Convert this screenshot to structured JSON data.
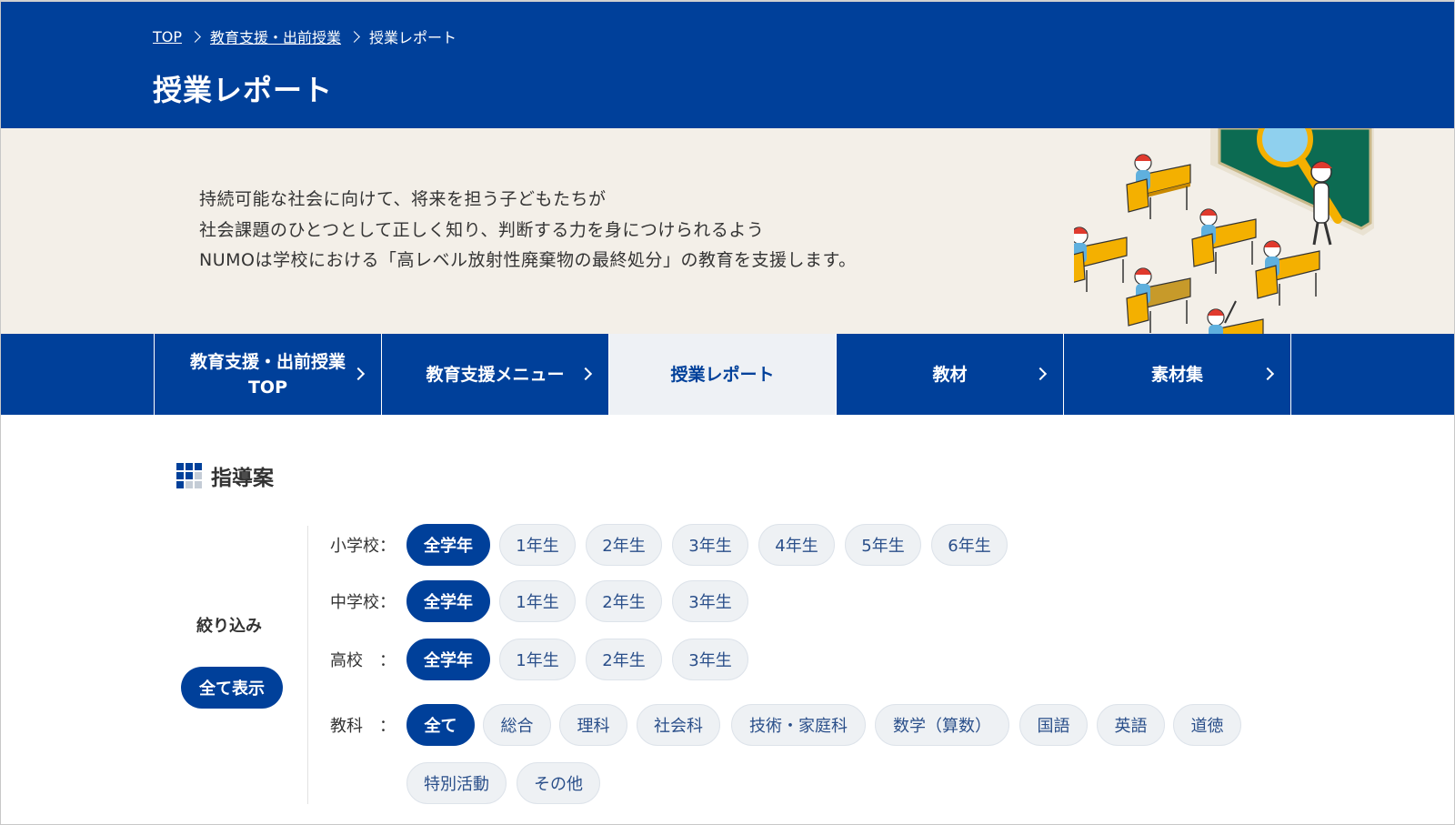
{
  "breadcrumb": {
    "home": "TOP",
    "parent": "教育支援・出前授業",
    "current": "授業レポート"
  },
  "page_title": "授業レポート",
  "intro": {
    "line1": "持続可能な社会に向けて、将来を担う子どもたちが",
    "line2": "社会課題のひとつとして正しく知り、判断する力を身につけられるよう",
    "line3": "NUMOは学校における「高レベル放射性廃棄物の最終処分」の教育を支援します。"
  },
  "nav": {
    "items": [
      {
        "line1": "教育支援・出前授業",
        "line2": "TOP"
      },
      {
        "line1": "教育支援メニュー",
        "line2": ""
      },
      {
        "line1": "授業レポート",
        "line2": ""
      },
      {
        "line1": "教材",
        "line2": ""
      },
      {
        "line1": "素材集",
        "line2": ""
      }
    ]
  },
  "section": {
    "title": "指導案"
  },
  "filter": {
    "label": "絞り込み",
    "show_all": "全て表示",
    "elementary": {
      "label": "小学校：",
      "chips": [
        "全学年",
        "1年生",
        "2年生",
        "3年生",
        "4年生",
        "5年生",
        "6年生"
      ]
    },
    "junior": {
      "label": "中学校：",
      "chips": [
        "全学年",
        "1年生",
        "2年生",
        "3年生"
      ]
    },
    "high": {
      "label": "高校　：",
      "chips": [
        "全学年",
        "1年生",
        "2年生",
        "3年生"
      ]
    },
    "subject": {
      "label": "教科　：",
      "chips": [
        "全て",
        "総合",
        "理科",
        "社会科",
        "技術・家庭科",
        "数学（算数）",
        "国語",
        "英語",
        "道徳",
        "特別活動",
        "その他"
      ]
    }
  },
  "colors": {
    "brand": "#00409a",
    "intro_bg": "#f3efe8",
    "chip_bg": "#eef1f4",
    "active_tab_bg": "#eef1f5"
  }
}
